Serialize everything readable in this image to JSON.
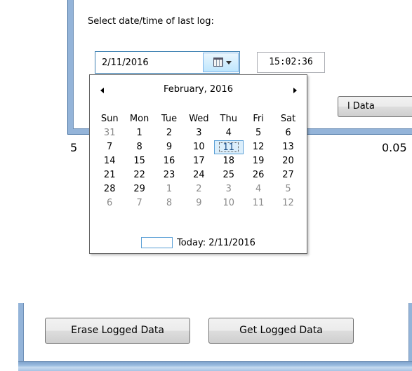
{
  "top_dialog": {
    "prompt": "Select date/time of last log:",
    "date_value": "2/11/2016",
    "time_value": "15:02:36",
    "partial_button_label": "l Data",
    "partial_text_left": "5",
    "partial_text_right": "0.05"
  },
  "calendar": {
    "month_title": "February, 2016",
    "days_of_week": [
      "Sun",
      "Mon",
      "Tue",
      "Wed",
      "Thu",
      "Fri",
      "Sat"
    ],
    "weeks": [
      [
        "31",
        "1",
        "2",
        "3",
        "4",
        "5",
        "6"
      ],
      [
        "7",
        "8",
        "9",
        "10",
        "11",
        "12",
        "13"
      ],
      [
        "14",
        "15",
        "16",
        "17",
        "18",
        "19",
        "20"
      ],
      [
        "21",
        "22",
        "23",
        "24",
        "25",
        "26",
        "27"
      ],
      [
        "28",
        "29",
        "1",
        "2",
        "3",
        "4",
        "5"
      ],
      [
        "6",
        "7",
        "8",
        "9",
        "10",
        "11",
        "12"
      ]
    ],
    "selected_day": "11",
    "today_label": "Today: 2/11/2016"
  },
  "bottom_window": {
    "erase_label": "Erase Logged Data",
    "get_label": "Get Logged Data"
  },
  "colors": {
    "window_frame": "#94b4d9",
    "selection_border": "#5a9fd6",
    "other_month_text": "#8a8a8a"
  }
}
